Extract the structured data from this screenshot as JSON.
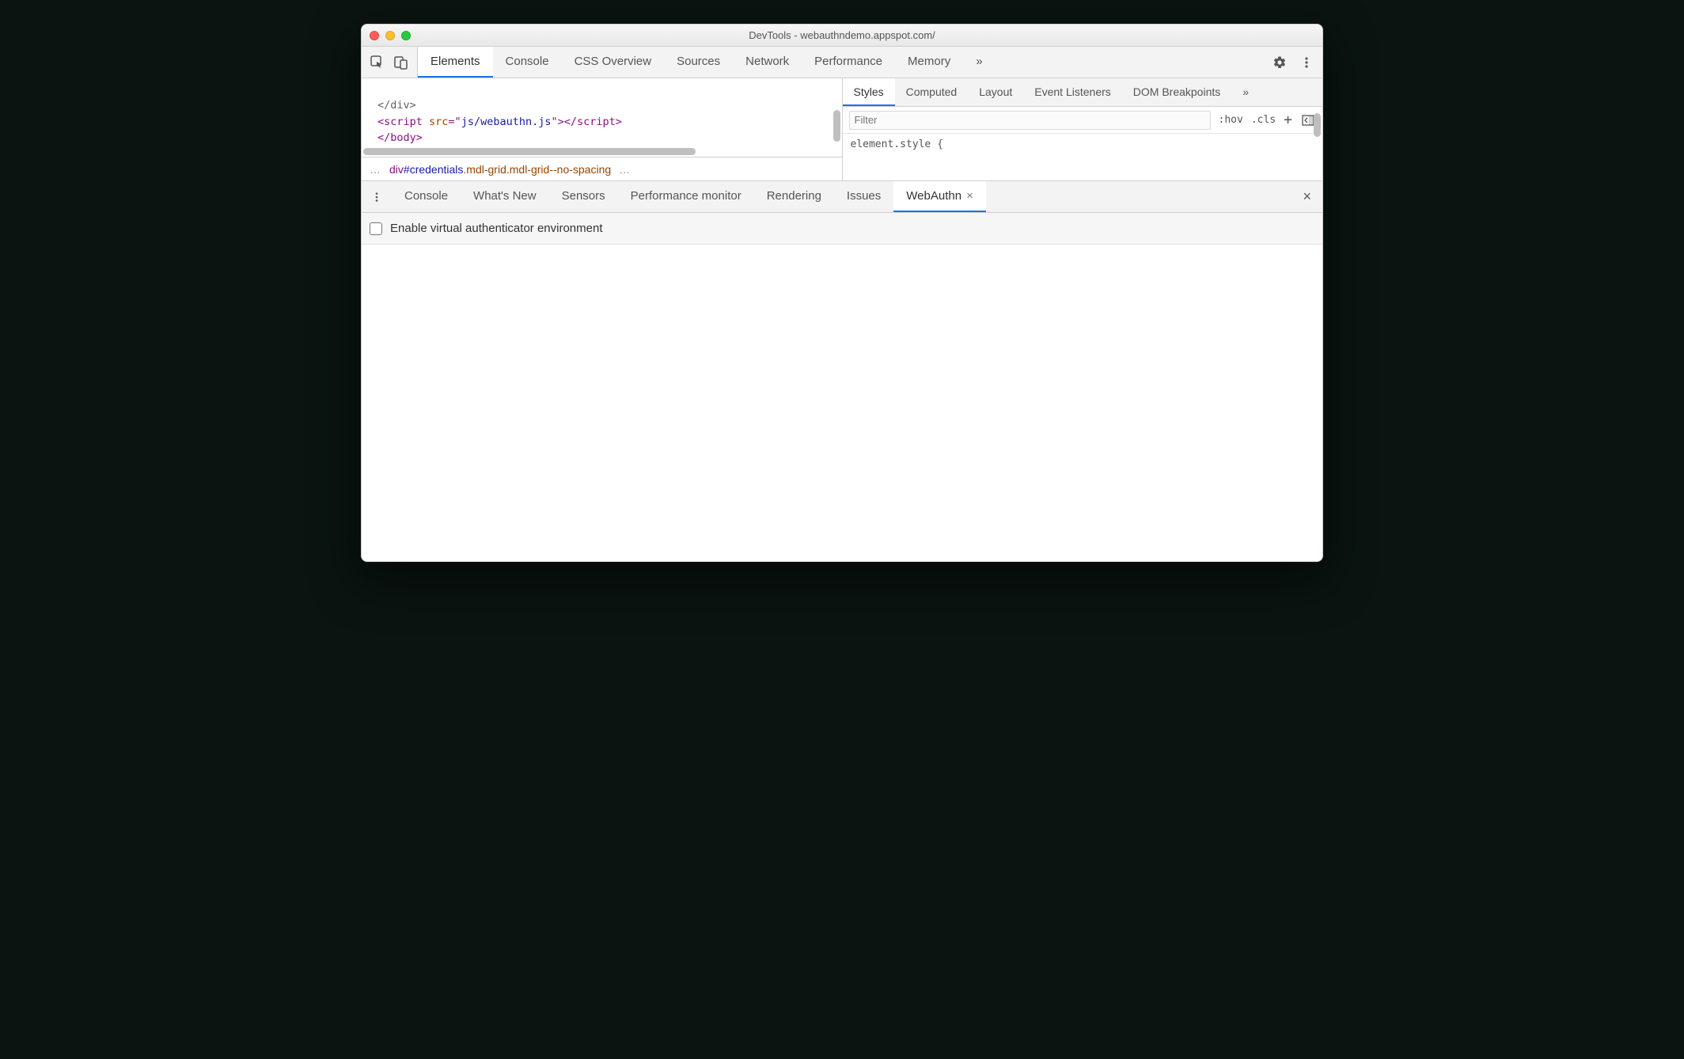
{
  "window": {
    "title": "DevTools - webauthndemo.appspot.com/"
  },
  "main_tabs": {
    "items": [
      "Elements",
      "Console",
      "CSS Overview",
      "Sources",
      "Network",
      "Performance",
      "Memory"
    ],
    "active_index": 0,
    "overflow": "»"
  },
  "code": {
    "line1_close_div": "</div>",
    "line2_open": "<script ",
    "line2_attr": "src",
    "line2_eq": "=\"",
    "line2_val": "js/webauthn.js",
    "line2_q2": "\">",
    "line2_close": "</",
    "line2_close2": "script>",
    "line3": "</body>"
  },
  "breadcrumb": {
    "left_dots": "…",
    "div": "div",
    "hash_id": "#credentials",
    "cls1": ".mdl-grid",
    "cls2": ".mdl-grid--no-spacing",
    "right_dots": "…"
  },
  "styles_tabs": {
    "items": [
      "Styles",
      "Computed",
      "Layout",
      "Event Listeners",
      "DOM Breakpoints"
    ],
    "active_index": 0,
    "overflow": "»"
  },
  "filter": {
    "placeholder": "Filter",
    "hov": ":hov",
    "cls": ".cls",
    "plus": "+"
  },
  "element_style_text": "element.style {",
  "drawer_tabs": {
    "items": [
      "Console",
      "What's New",
      "Sensors",
      "Performance monitor",
      "Rendering",
      "Issues",
      "WebAuthn"
    ],
    "active_index": 6
  },
  "webauthn": {
    "checkbox_label": "Enable virtual authenticator environment"
  }
}
